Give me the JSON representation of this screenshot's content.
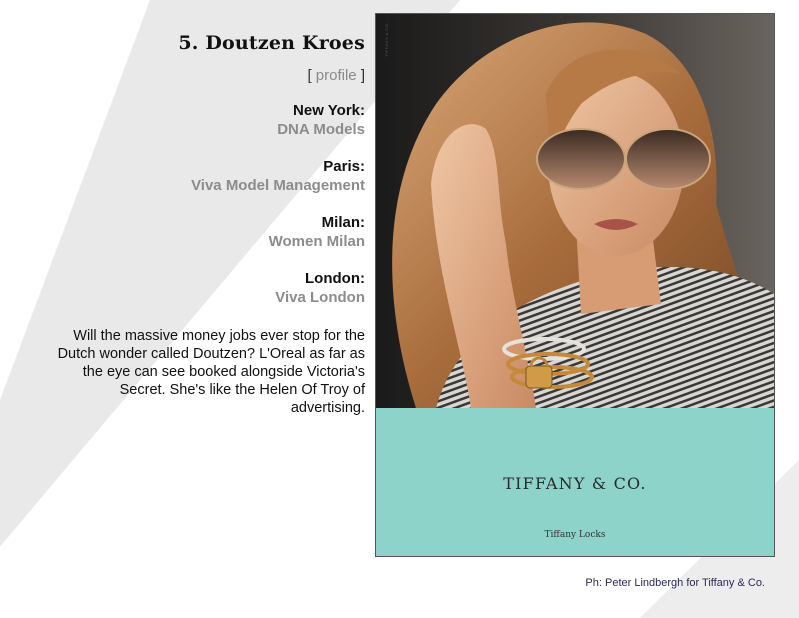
{
  "model": {
    "rank_title": "5. Doutzen Kroes",
    "profile_open": "[ ",
    "profile_link": "profile",
    "profile_close": " ]"
  },
  "agencies": [
    {
      "city": "New York:",
      "agency": "DNA Models"
    },
    {
      "city": "Paris:",
      "agency": "Viva Model Management"
    },
    {
      "city": "Milan:",
      "agency": "Women Milan"
    },
    {
      "city": "London:",
      "agency": "Viva London"
    }
  ],
  "blurb": "Will the massive money jobs ever stop for the Dutch wonder called Doutzen? L'Oreal as far as the eye can see booked alongside Victoria's Secret. She's like the Helen Of Troy of advertising.",
  "ad": {
    "brand": "TIFFANY & CO.",
    "tagline": "Tiffany Locks",
    "brand_color": "#8ed3ca"
  },
  "caption": "Ph: Peter Lindbergh for Tiffany & Co."
}
